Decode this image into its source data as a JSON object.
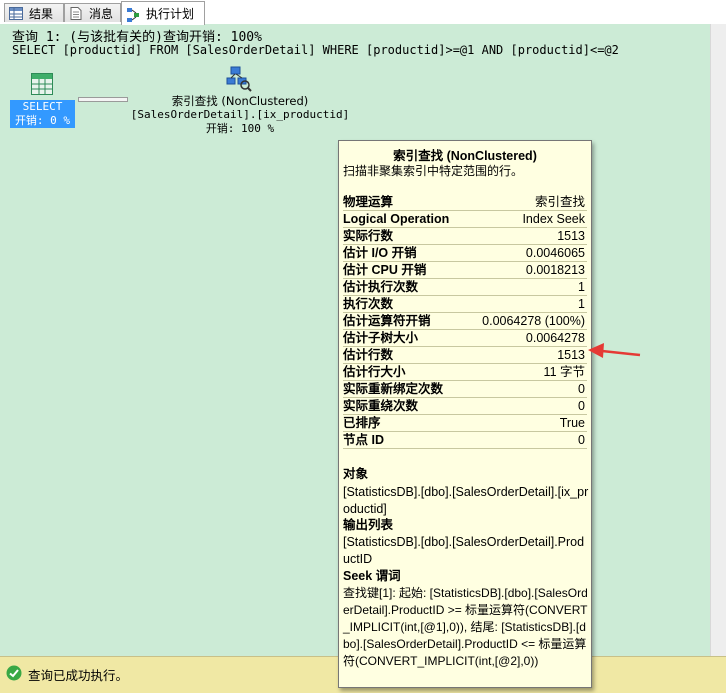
{
  "tabs": [
    {
      "label": "结果",
      "icon": "grid-icon"
    },
    {
      "label": "消息",
      "icon": "document-icon"
    },
    {
      "label": "执行计划",
      "icon": "execution-plan-icon"
    }
  ],
  "query": {
    "header": "查询 1: (与该批有关的)查询开销: 100%",
    "sql": "SELECT [productid] FROM [SalesOrderDetail] WHERE [productid]>=@1 AND [productid]<=@2"
  },
  "plan": {
    "select_node": {
      "name": "SELECT",
      "cost": "开销: 0 %"
    },
    "seek_node": {
      "op": "索引查找 (NonClustered)",
      "object": "[SalesOrderDetail].[ix_productid]",
      "cost": "开销: 100 %"
    }
  },
  "tooltip": {
    "title": "索引查找 (NonClustered)",
    "description": "扫描非聚集索引中特定范围的行。",
    "properties": [
      {
        "key": "物理运算",
        "value": "索引查找"
      },
      {
        "key": "Logical Operation",
        "value": "Index Seek"
      },
      {
        "key": "实际行数",
        "value": "1513"
      },
      {
        "key": "估计 I/O 开销",
        "value": "0.0046065"
      },
      {
        "key": "估计 CPU 开销",
        "value": "0.0018213"
      },
      {
        "key": "估计执行次数",
        "value": "1"
      },
      {
        "key": "执行次数",
        "value": "1"
      },
      {
        "key": "估计运算符开销",
        "value": "0.0064278 (100%)"
      },
      {
        "key": "估计子树大小",
        "value": "0.0064278"
      },
      {
        "key": "估计行数",
        "value": "1513"
      },
      {
        "key": "估计行大小",
        "value": "11 字节"
      },
      {
        "key": "实际重新绑定次数",
        "value": "0"
      },
      {
        "key": "实际重绕次数",
        "value": "0"
      },
      {
        "key": "已排序",
        "value": "True"
      },
      {
        "key": "节点 ID",
        "value": "0"
      }
    ],
    "object_label": "对象",
    "object_value": "[StatisticsDB].[dbo].[SalesOrderDetail].[ix_productid]",
    "output_label": "输出列表",
    "output_value": "[StatisticsDB].[dbo].[SalesOrderDetail].ProductID",
    "seek_label": "Seek 谓词",
    "seek_value": "查找键[1]: 起始: [StatisticsDB].[dbo].[SalesOrderDetail].ProductID >= 标量运算符(CONVERT_IMPLICIT(int,[@1],0)), 结尾: [StatisticsDB].[dbo].[SalesOrderDetail].ProductID <= 标量运算符(CONVERT_IMPLICIT(int,[@2],0))"
  },
  "status": {
    "text": "查询已成功执行。",
    "icon": "success-check-icon"
  },
  "colors": {
    "plan_bg": "#ccebd6",
    "tooltip_bg": "#ffffe1",
    "status_bg": "#f0e8a4",
    "selected_node": "#3399ff",
    "arrow": "#e53935"
  }
}
